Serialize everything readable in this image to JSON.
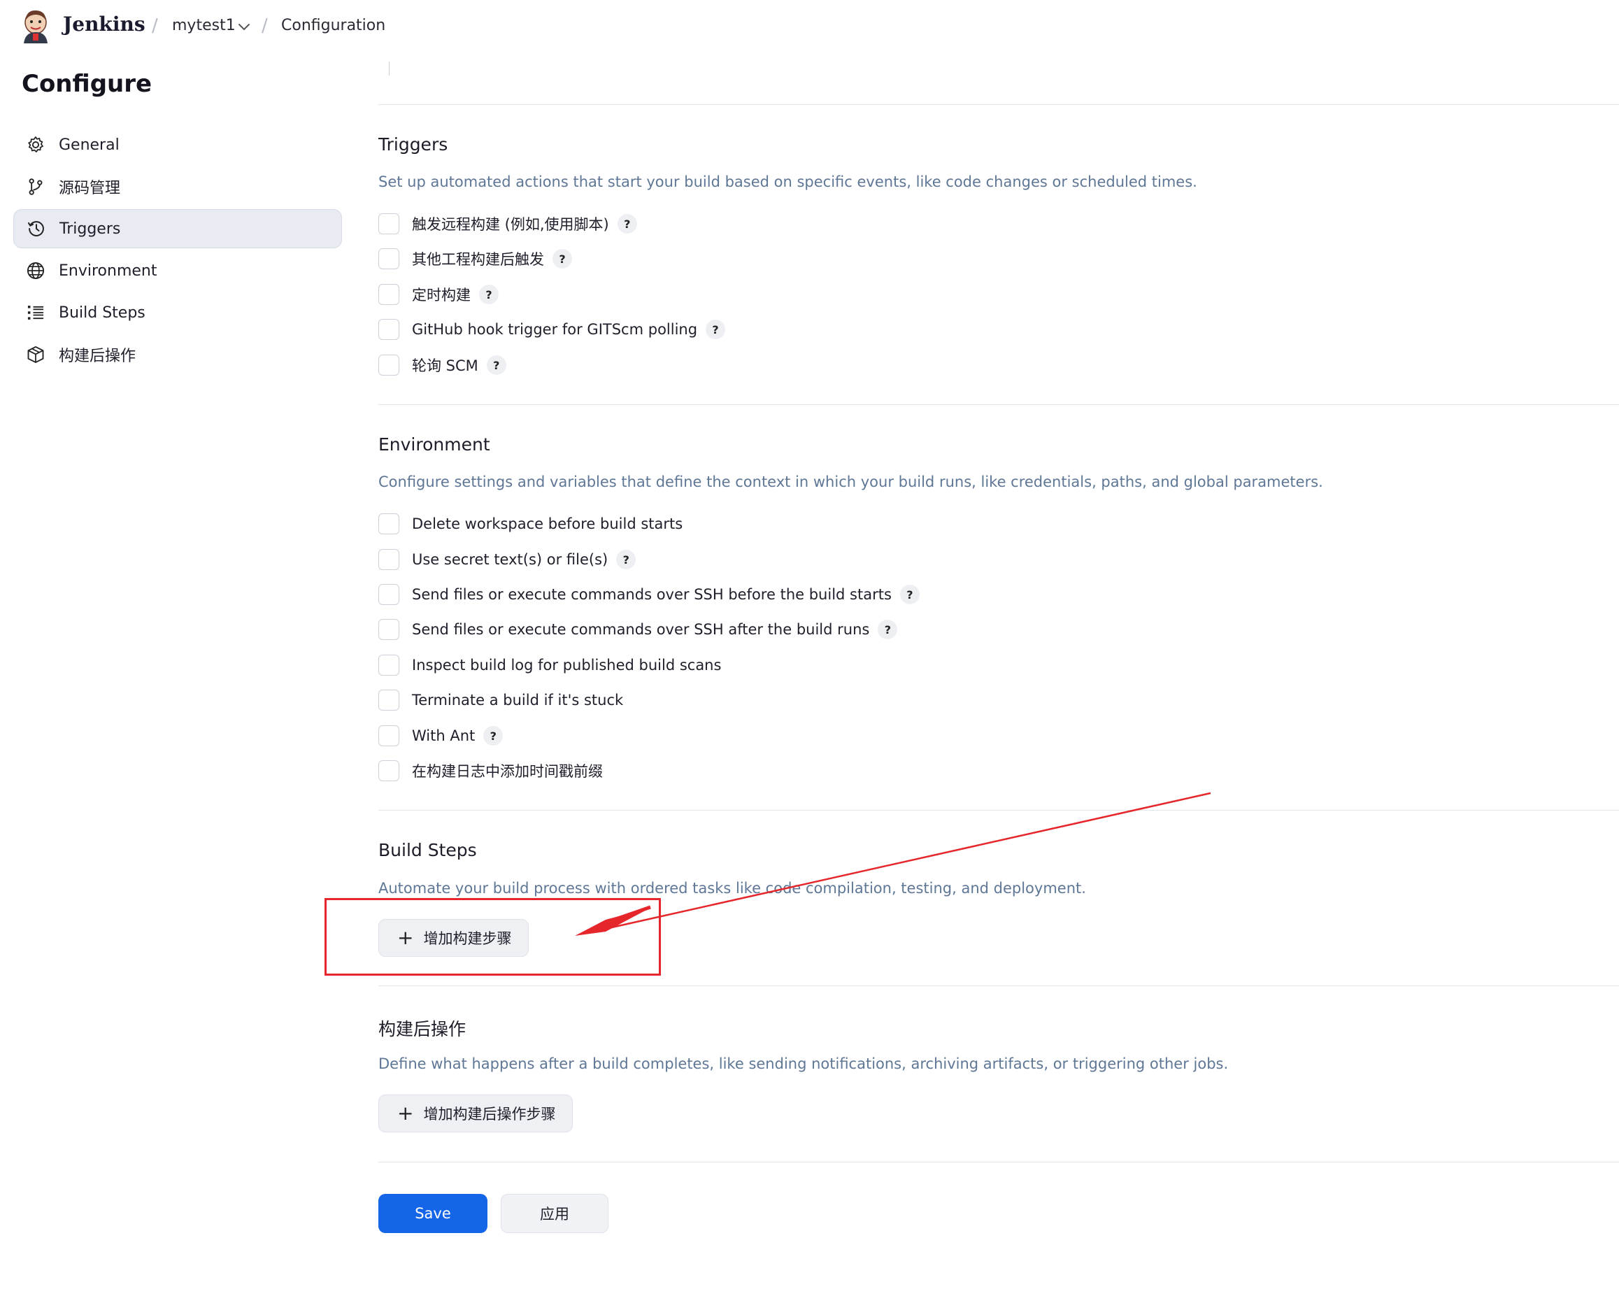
{
  "header": {
    "brand": "Jenkins",
    "project": "mytest1",
    "page": "Configuration",
    "separator": "/"
  },
  "page_title": "Configure",
  "sidebar": {
    "items": [
      {
        "label": "General",
        "icon": "gear-icon"
      },
      {
        "label": "源码管理",
        "icon": "branch-icon"
      },
      {
        "label": "Triggers",
        "icon": "clock-icon",
        "active": true
      },
      {
        "label": "Environment",
        "icon": "globe-icon"
      },
      {
        "label": "Build Steps",
        "icon": "list-icon"
      },
      {
        "label": "构建后操作",
        "icon": "package-icon"
      }
    ]
  },
  "triggers": {
    "title": "Triggers",
    "description": "Set up automated actions that start your build based on specific events, like code changes or scheduled times.",
    "options": [
      {
        "label": "触发远程构建 (例如,使用脚本)",
        "help": true
      },
      {
        "label": "其他工程构建后触发",
        "help": true
      },
      {
        "label": "定时构建",
        "help": true
      },
      {
        "label": "GitHub hook trigger for GITScm polling",
        "help": true
      },
      {
        "label": "轮询 SCM",
        "help": true
      }
    ]
  },
  "environment": {
    "title": "Environment",
    "description": "Configure settings and variables that define the context in which your build runs, like credentials, paths, and global parameters.",
    "options": [
      {
        "label": "Delete workspace before build starts",
        "help": false
      },
      {
        "label": "Use secret text(s) or file(s)",
        "help": true
      },
      {
        "label": "Send files or execute commands over SSH before the build starts",
        "help": true
      },
      {
        "label": "Send files or execute commands over SSH after the build runs",
        "help": true
      },
      {
        "label": "Inspect build log for published build scans",
        "help": false
      },
      {
        "label": "Terminate a build if it's stuck",
        "help": false
      },
      {
        "label": "With Ant",
        "help": true
      },
      {
        "label": "在构建日志中添加时间戳前缀",
        "help": false
      }
    ]
  },
  "build_steps": {
    "title": "Build Steps",
    "description": "Automate your build process with ordered tasks like code compilation, testing, and deployment.",
    "add_label": "增加构建步骤"
  },
  "post_build": {
    "title": "构建后操作",
    "description": "Define what happens after a build completes, like sending notifications, archiving artifacts, or triggering other jobs.",
    "add_label": "增加构建后操作步骤"
  },
  "help_glyph": "?",
  "plus_glyph": "+",
  "actions": {
    "save": "Save",
    "apply": "应用"
  },
  "colors": {
    "accent": "#1565e8",
    "description": "#5f7796",
    "annotation": "#e5262b",
    "active_nav": "#e8ebf2"
  }
}
